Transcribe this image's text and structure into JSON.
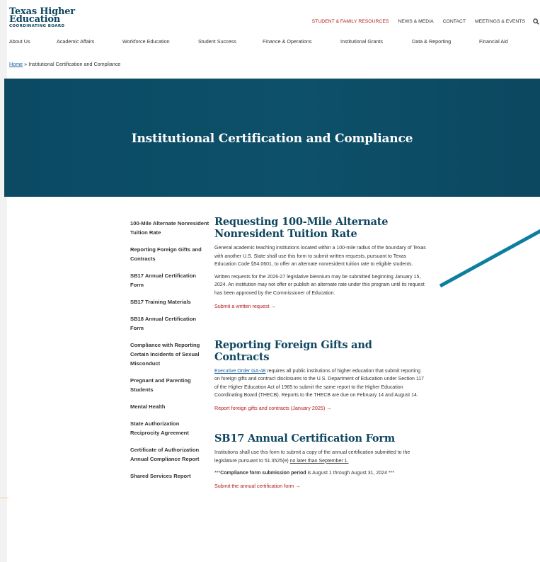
{
  "logo": {
    "line1": "Texas Higher",
    "line2": "Education",
    "line3": "COORDINATING BOARD"
  },
  "topnav": {
    "items": [
      "STUDENT & FAMILY RESOURCES",
      "NEWS & MEDIA",
      "CONTACT",
      "MEETINGS & EVENTS"
    ],
    "search_icon": "search-icon"
  },
  "mainnav": {
    "items": [
      "About Us",
      "Academic Affairs",
      "Workforce Education",
      "Student Success",
      "Finance & Operations",
      "Institutional Grants",
      "Data & Reporting",
      "Financial Aid"
    ]
  },
  "breadcrumb": {
    "home": "Home",
    "separator": " » ",
    "current": "Institutional Certification and Compliance"
  },
  "hero": {
    "title": "Institutional Certification and Compliance"
  },
  "sidenav": {
    "items": [
      "100-Mile Alternate Nonresident Tuition Rate",
      "Reporting Foreign Gifts and Contracts",
      "SB17 Annual Certification Form",
      "SB17 Training Materials",
      "SB18 Annual Certification Form",
      "Compliance with Reporting Certain Incidents of Sexual Misconduct",
      "Pregnant and Parenting Students",
      "Mental Health",
      "State Authorization Reciprocity Agreement",
      "Certificate of Authorization Annual Compliance Report",
      "Shared Services Report"
    ]
  },
  "sections": {
    "s1": {
      "title": "Requesting 100-Mile Alternate Nonresident Tuition Rate",
      "p1": "General academic teaching institutions located within a 100-mile radius of the boundary of Texas with another U.S. State shall use this form to submit written requests, pursuant to Texas Education Code §54.0601, to offer an alternate nonresident tuition rate to eligible students.",
      "p2": "Written requests for the 2026-27 legislative biennium may be submitted beginning January 15, 2024. An institution may not offer or publish an alternate rate under this program until its request has been approved by the Commissioner of Education.",
      "cta": "Submit a written request  →"
    },
    "s2": {
      "title": "Reporting Foreign Gifts and Contracts",
      "link": "Executive Order GA-48",
      "p1": " requires all public institutions of higher education that submit reporting on foreign gifts and contract disclosures to the U.S. Department of Education under Section 117 of the Higher Education Act of 1965 to submit the same report to the Higher Education Coordinating Board (THECB). Reports to the THECB are due on February 14 and August 14.",
      "cta": "Report foreign gifts and contracts (January 2025)  →"
    },
    "s3": {
      "title": "SB17 Annual Certification Form",
      "p1": "Institutions shall use this form to submit a copy of the annual certification submitted to the legislature pursuant to 51.3525(e) ",
      "p1_underlined": "no later than September 1.",
      "p2_prefix": "***",
      "p2_bold": "Compliance form submission period",
      "p2_rest": " is August 1 through August 31, 2024 ***",
      "cta": "Submit the annual certification form  →"
    }
  },
  "colors": {
    "brand_navy": "#0f4660",
    "hero_bg": "#0d4d66",
    "accent_red": "#b31b1b",
    "link_blue": "#1a5e9a",
    "annotation_line": "#0e7ea0"
  }
}
